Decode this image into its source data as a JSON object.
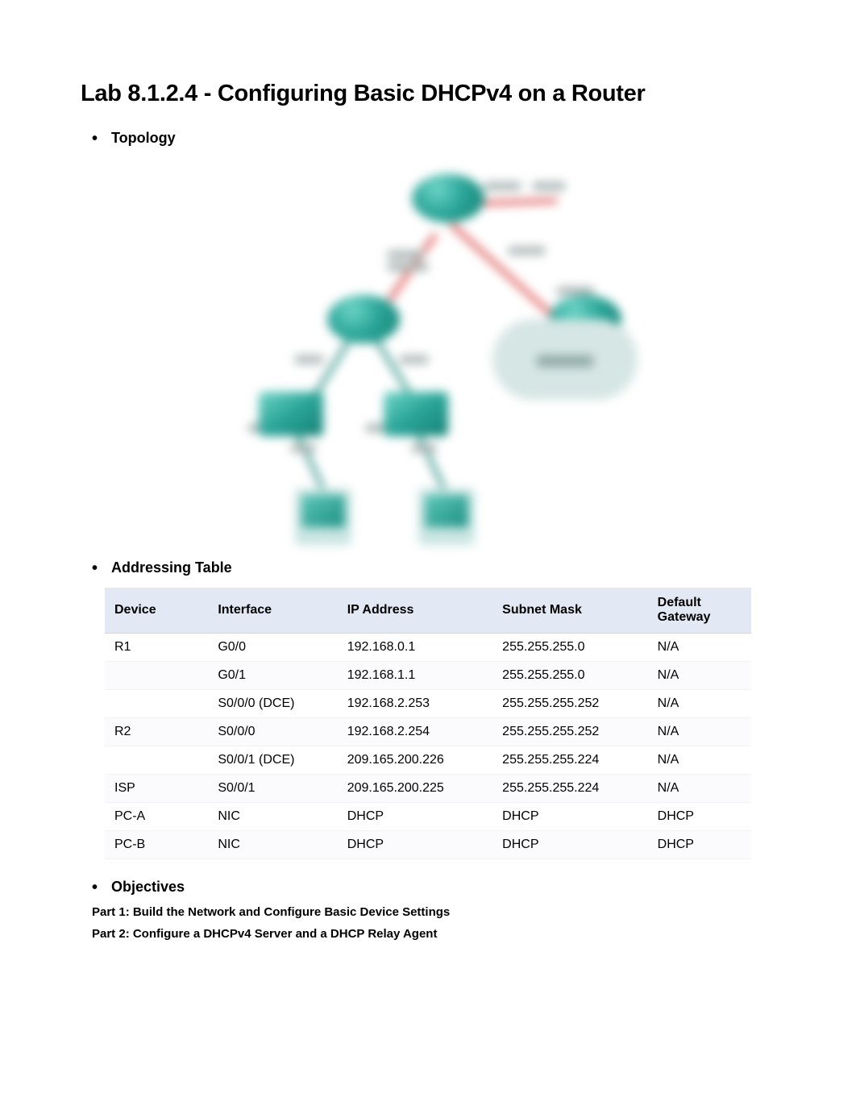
{
  "title": "Lab 8.1.2.4 - Configuring Basic DHCPv4 on a Router",
  "sections": {
    "topology": "Topology",
    "addressing": "Addressing Table",
    "objectives": "Objectives"
  },
  "addressing_table": {
    "headers": {
      "device": "Device",
      "interface": "Interface",
      "ip": "IP Address",
      "mask": "Subnet Mask",
      "gateway": "Default Gateway"
    },
    "rows": [
      {
        "device": "R1",
        "interface": "G0/0",
        "ip": "192.168.0.1",
        "mask": "255.255.255.0",
        "gateway": "N/A"
      },
      {
        "device": "",
        "interface": "G0/1",
        "ip": "192.168.1.1",
        "mask": "255.255.255.0",
        "gateway": "N/A"
      },
      {
        "device": "",
        "interface": "S0/0/0 (DCE)",
        "ip": "192.168.2.253",
        "mask": "255.255.255.252",
        "gateway": "N/A"
      },
      {
        "device": "R2",
        "interface": "S0/0/0",
        "ip": "192.168.2.254",
        "mask": "255.255.255.252",
        "gateway": "N/A"
      },
      {
        "device": "",
        "interface": "S0/0/1 (DCE)",
        "ip": "209.165.200.226",
        "mask": "255.255.255.224",
        "gateway": "N/A"
      },
      {
        "device": "ISP",
        "interface": "S0/0/1",
        "ip": "209.165.200.225",
        "mask": "255.255.255.224",
        "gateway": "N/A"
      },
      {
        "device": "PC-A",
        "interface": "NIC",
        "ip": "DHCP",
        "mask": "DHCP",
        "gateway": "DHCP"
      },
      {
        "device": "PC-B",
        "interface": "NIC",
        "ip": "DHCP",
        "mask": "DHCP",
        "gateway": "DHCP"
      }
    ]
  },
  "objectives": {
    "parts": [
      "Part 1: Build the Network and Configure Basic Device Settings",
      "Part 2: Configure a DHCPv4 Server and a DHCP Relay Agent"
    ]
  }
}
